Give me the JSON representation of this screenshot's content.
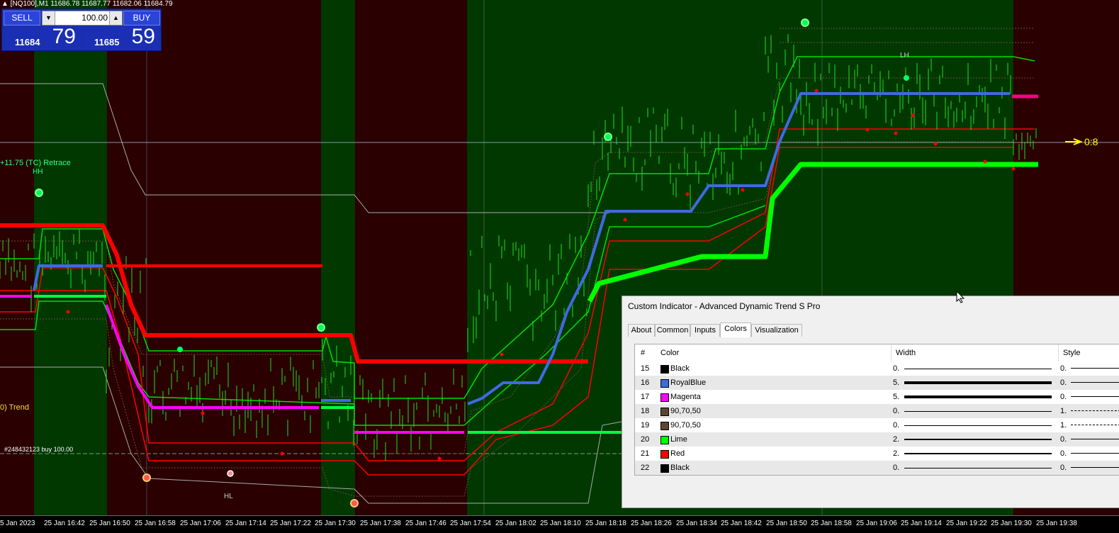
{
  "chart_header": "▲ [NQ100],M1  11686.78 11687.77 11682.06 11684.79",
  "trade_panel": {
    "sell_label": "SELL",
    "buy_label": "BUY",
    "lots": "100.00",
    "sell_prefix": "11684",
    "sell_big": "79",
    "buy_prefix": "11685",
    "buy_big": "59"
  },
  "annotations": {
    "retrace": "+11.75 (TC) Retrace",
    "hh": "HH",
    "lh": "LH",
    "hl": "HL",
    "trend": "0) Trend",
    "order": "#248432123 buy 100.00",
    "right_marker": "0:8"
  },
  "x_axis": [
    "5 Jan 2023",
    "25 Jan 16:42",
    "25 Jan 16:50",
    "25 Jan 16:58",
    "25 Jan 17:06",
    "25 Jan 17:14",
    "25 Jan 17:22",
    "25 Jan 17:30",
    "25 Jan 17:38",
    "25 Jan 17:46",
    "25 Jan 17:54",
    "25 Jan 18:02",
    "25 Jan 18:10",
    "25 Jan 18:18",
    "25 Jan 18:26",
    "25 Jan 18:34",
    "25 Jan 18:42",
    "25 Jan 18:50",
    "25 Jan 18:58",
    "25 Jan 19:06",
    "25 Jan 19:14",
    "25 Jan 19:22",
    "25 Jan 19:30",
    "25 Jan 19:38"
  ],
  "dialog": {
    "title": "Custom Indicator - Advanced Dynamic Trend S Pro",
    "tabs": [
      "About",
      "Common",
      "Inputs",
      "Colors",
      "Visualization"
    ],
    "active_tab": "Colors",
    "columns": [
      "#",
      "Color",
      "Width",
      "Style"
    ],
    "rows": [
      {
        "num": "15",
        "color": "Black",
        "hex": "#000000",
        "width": "0.",
        "style": "0.",
        "weight": 1,
        "dash": false
      },
      {
        "num": "16",
        "color": "RoyalBlue",
        "hex": "#4169e1",
        "width": "5.",
        "style": "0.",
        "weight": 4,
        "dash": false
      },
      {
        "num": "17",
        "color": "Magenta",
        "hex": "#ff00ff",
        "width": "5.",
        "style": "0.",
        "weight": 4,
        "dash": false
      },
      {
        "num": "18",
        "color": "90,70,50",
        "hex": "#5a4632",
        "width": "0.",
        "style": "1.",
        "weight": 1,
        "dash": true
      },
      {
        "num": "19",
        "color": "90,70,50",
        "hex": "#5a4632",
        "width": "0.",
        "style": "1.",
        "weight": 1,
        "dash": true
      },
      {
        "num": "20",
        "color": "Lime",
        "hex": "#00ff00",
        "width": "2.",
        "style": "0.",
        "weight": 2,
        "dash": false
      },
      {
        "num": "21",
        "color": "Red",
        "hex": "#ff0000",
        "width": "2.",
        "style": "0.",
        "weight": 2,
        "dash": false
      },
      {
        "num": "22",
        "color": "Black",
        "hex": "#000000",
        "width": "0.",
        "style": "0.",
        "weight": 1,
        "dash": false
      }
    ]
  },
  "colors": {
    "bull_bg": "#003800",
    "bear_bg": "#2a0000",
    "support": "#00ff40",
    "resistance": "#ff0000",
    "mid": "#4169e1",
    "magenta": "#ff00ff"
  }
}
